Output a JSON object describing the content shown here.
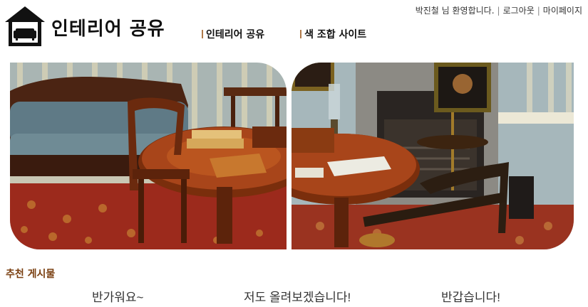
{
  "header": {
    "logo_icon": "house-sofa-icon",
    "site_title": "인테리어 공유",
    "greeting": "박진철 님 환영합니다.",
    "logout_label": "로그아웃",
    "mypage_label": "마이페이지"
  },
  "nav": {
    "items": [
      {
        "label": "인테리어 공유"
      },
      {
        "label": "색 조합 사이트"
      }
    ]
  },
  "hero": {
    "images": [
      {
        "icon": "parlor-sofa-table-photo"
      },
      {
        "icon": "fireplace-table-photo"
      }
    ]
  },
  "recommended": {
    "title": "추천 게시물",
    "posts": [
      {
        "title": "반가워요~"
      },
      {
        "title": "저도 올려보겠습니다!"
      },
      {
        "title": "반갑습니다!"
      }
    ]
  },
  "colors": {
    "section_title": "#7a3f10",
    "nav_bar": "#b07a4a"
  }
}
